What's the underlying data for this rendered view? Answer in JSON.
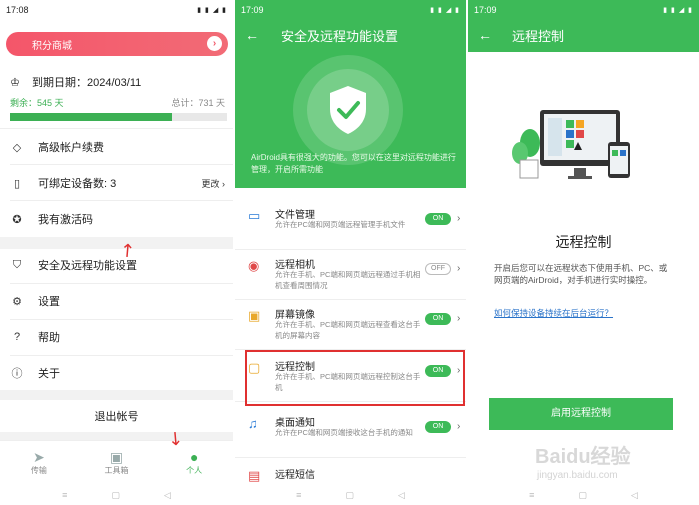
{
  "panel1": {
    "time": "17:08",
    "mall": "积分商城",
    "expire": "到期日期：2024/03/11",
    "remain": "剩余：545 天",
    "total": "总计：731 天",
    "progress": 0.745,
    "menu": [
      {
        "label": "高级帐户续费",
        "icon": "diamond-icon"
      },
      {
        "label": "可绑定设备数: 3",
        "right": "更改",
        "icon": "phone-icon"
      },
      {
        "label": "我有激活码",
        "icon": "badge-icon"
      },
      {
        "label": "安全及远程功能设置",
        "icon": "shield-icon"
      },
      {
        "label": "设置",
        "icon": "gear-icon"
      },
      {
        "label": "帮助",
        "icon": "help-icon"
      },
      {
        "label": "关于",
        "icon": "info-icon"
      }
    ],
    "logout": "退出帐号",
    "tabs": [
      "传输",
      "工具箱",
      "个人"
    ]
  },
  "panel2": {
    "time": "17:09",
    "title": "安全及远程功能设置",
    "desc": "AirDroid具有很强大的功能。您可以在这里对远程功能进行管理，开启所需功能",
    "features": [
      {
        "name": "文件管理",
        "desc": "允许在PC端和网页端远程管理手机文件",
        "state": "ON",
        "color": "#2a7bd6"
      },
      {
        "name": "远程相机",
        "desc": "允许在手机、PC端和网页端远程通过手机相机查看周围情况",
        "state": "OFF",
        "color": "#e04848"
      },
      {
        "name": "屏幕镜像",
        "desc": "允许在手机、PC端和网页端远程查看这台手机的屏幕内容",
        "state": "ON",
        "color": "#e8a82b"
      },
      {
        "name": "远程控制",
        "desc": "允许在手机、PC端和网页端远程控制这台手机",
        "state": "ON",
        "color": "#e8a82b"
      },
      {
        "name": "桌面通知",
        "desc": "允许在PC端和网页端接收这台手机的通知",
        "state": "ON",
        "color": "#2a7bd6"
      },
      {
        "name": "远程短信",
        "desc": "",
        "state": "",
        "color": "#e04848"
      }
    ]
  },
  "panel3": {
    "time": "17:09",
    "title": "远程控制",
    "heading": "远程控制",
    "desc": "开启后您可以在远程状态下使用手机、PC、或网页端的AirDroid，对手机进行实时操控。",
    "link": "如何保持设备持续在后台运行？",
    "button": "启用远程控制"
  },
  "watermark": {
    "brand": "Baidu经验",
    "url": "jingyan.baidu.com"
  }
}
